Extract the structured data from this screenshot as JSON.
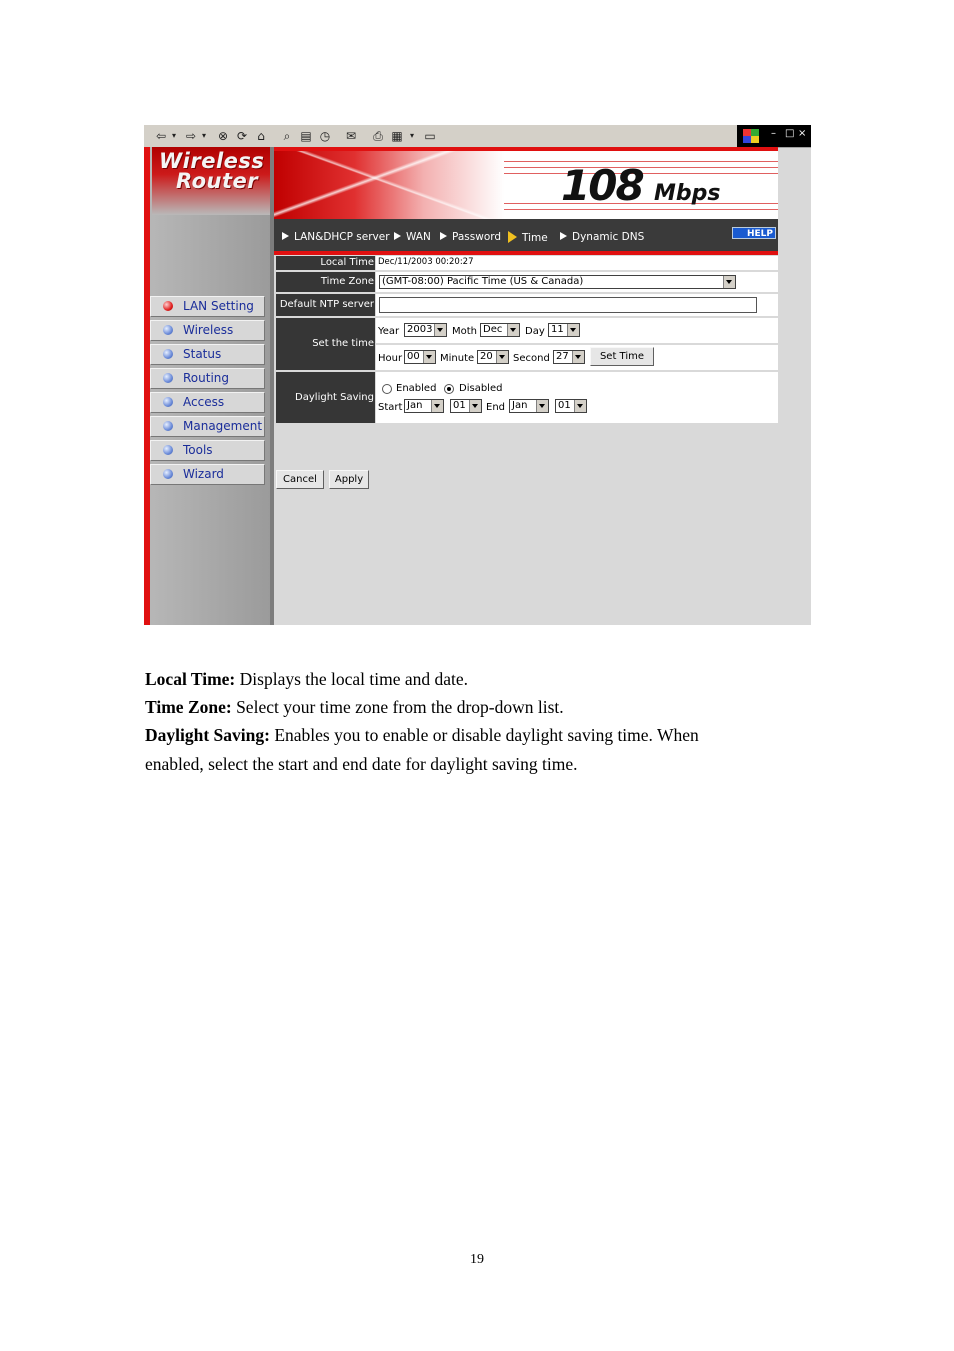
{
  "browser": {
    "toolbar_icons": [
      "back-icon",
      "forward-icon",
      "stop-icon",
      "refresh-icon",
      "home-icon",
      "search-icon",
      "favorites-icon",
      "history-icon",
      "mail-icon",
      "print-icon",
      "edit-icon",
      "discuss-icon"
    ],
    "window_controls": [
      "–",
      "□",
      "×"
    ]
  },
  "router": {
    "logo_line1": "Wireless",
    "logo_line2": "Router",
    "banner_number": "108",
    "banner_unit": "Mbps",
    "help_label": "HELP",
    "top_nav": [
      {
        "label": "LAN&DHCP server",
        "current": false
      },
      {
        "label": "WAN",
        "current": false
      },
      {
        "label": "Password",
        "current": false
      },
      {
        "label": "Time",
        "current": true
      },
      {
        "label": "Dynamic DNS",
        "current": false
      }
    ],
    "side_menu": [
      {
        "label": "LAN Setting",
        "active": true
      },
      {
        "label": "Wireless",
        "active": false
      },
      {
        "label": "Status",
        "active": false
      },
      {
        "label": "Routing",
        "active": false
      },
      {
        "label": "Access",
        "active": false
      },
      {
        "label": "Management",
        "active": false
      },
      {
        "label": "Tools",
        "active": false
      },
      {
        "label": "Wizard",
        "active": false
      }
    ],
    "form": {
      "local_time_label": "Local Time",
      "local_time_value": "Dec/11/2003 00:20:27",
      "time_zone_label": "Time Zone",
      "time_zone_value": "(GMT-08:00) Pacific Time (US & Canada)",
      "ntp_label": "Default NTP server",
      "ntp_value": "",
      "set_time_label": "Set the time",
      "year_label": "Year",
      "year_value": "2003",
      "month_label": "Moth",
      "month_value": "Dec",
      "day_label": "Day",
      "day_value": "11",
      "hour_label": "Hour",
      "hour_value": "00",
      "minute_label": "Minute",
      "minute_value": "20",
      "second_label": "Second",
      "second_value": "27",
      "set_time_button": "Set Time",
      "daylight_label": "Daylight Saving",
      "enabled_label": "Enabled",
      "disabled_label": "Disabled",
      "daylight_selected": "Disabled",
      "start_label": "Start",
      "start_month": "Jan",
      "start_day": "01",
      "end_label": "End",
      "end_month": "Jan",
      "end_day": "01",
      "cancel_button": "Cancel",
      "apply_button": "Apply"
    }
  },
  "doc": {
    "p1_bold": "Local Time:",
    "p1_text": " Displays the local time and date.",
    "p2_bold": "Time Zone:",
    "p2_text": " Select your time zone from the drop-down list.",
    "p3_bold": "Daylight Saving:",
    "p3_text": " Enables you to enable or disable daylight saving time. When enabled, select the start and end date for daylight saving time.",
    "page_number": "19"
  },
  "colors": {
    "accent_red": "#e01010",
    "nav_dark": "#3a3a3a",
    "label_dark": "#363636",
    "menu_text": "#1a2d9a",
    "help_blue": "#1a5bd0"
  }
}
